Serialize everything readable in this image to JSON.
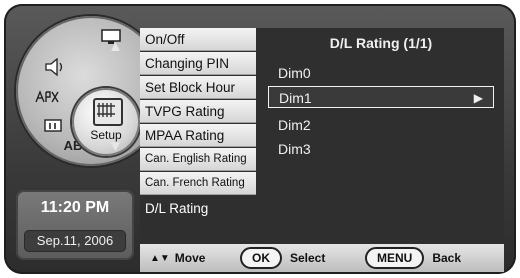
{
  "wheel": {
    "segments": [
      {
        "name": "source-icon"
      },
      {
        "name": "sound-icon"
      },
      {
        "name": "channel-icon"
      },
      {
        "name": "time-icon"
      },
      {
        "name": "ab-icon",
        "text": "AB"
      }
    ],
    "center_label": "Setup",
    "up_arrow": "▲",
    "down_arrow": "▼"
  },
  "clock": {
    "time": "11:20 PM",
    "date": "Sep.11, 2006"
  },
  "menu": {
    "items": [
      {
        "label": "On/Off"
      },
      {
        "label": "Changing PIN"
      },
      {
        "label": "Set Block Hour"
      },
      {
        "label": "TVPG Rating"
      },
      {
        "label": "MPAA Rating"
      },
      {
        "label": "Can. English Rating"
      },
      {
        "label": "Can. French Rating"
      },
      {
        "label": "D/L Rating"
      }
    ],
    "active_index": 7
  },
  "panel": {
    "title": "D/L Rating (1/1)",
    "options": [
      {
        "label": "Dim0"
      },
      {
        "label": "Dim1"
      },
      {
        "label": "Dim2"
      },
      {
        "label": "Dim3"
      }
    ],
    "selected_index": 1,
    "selected_arrow": "▶"
  },
  "bottom": {
    "move_arrows": "▲▼",
    "move_label": "Move",
    "ok_key": "OK",
    "select_label": "Select",
    "menu_key": "MENU",
    "back_label": "Back"
  }
}
